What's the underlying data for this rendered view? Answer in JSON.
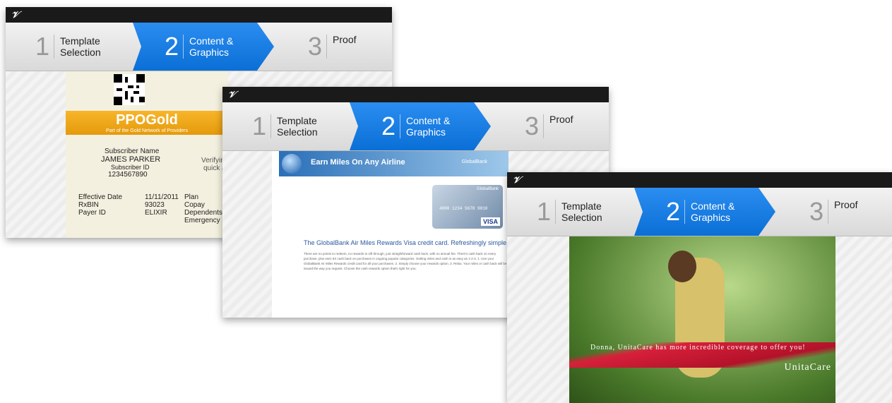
{
  "app": {
    "logo": "𝒱"
  },
  "steps": [
    {
      "num": "1",
      "label1": "Template",
      "label2": "Selection"
    },
    {
      "num": "2",
      "label1": "Content &",
      "label2": "Graphics"
    },
    {
      "num": "3",
      "label1": "Proof",
      "label2": ""
    }
  ],
  "window1": {
    "brand_main": "PPOGold",
    "brand_sub": "Part of the Gold Network of Providers",
    "subscriber_name_label": "Subscriber Name",
    "subscriber_name": "JAMES PARKER",
    "subscriber_id_label": "Subscriber ID",
    "subscriber_id": "1234567890",
    "verify_text": "Verifyin",
    "verify_text2": "quick a",
    "rows": [
      {
        "label": "Effective Date",
        "value": "11/11/2011",
        "col3": "Plan"
      },
      {
        "label": "RxBIN",
        "value": "93023",
        "col3": "Copay"
      },
      {
        "label": "Payer ID",
        "value": "ELIXIR",
        "col3": "Dependents"
      },
      {
        "label": "",
        "value": "",
        "col3": "Emergency"
      }
    ]
  },
  "window2": {
    "banner_text": "Earn Miles On Any Airline",
    "banner_brand": "GlobalBank",
    "card_brand": "GlobalBank",
    "card_number": "4000 1234 5678 9010",
    "visa": "VISA",
    "title": "The GlobalBank Air Miles Rewards Visa credit card. Refreshingly simple.",
    "body": "There are no points to redeem, no rewards to sift through, just straightforward cash back, with no annual fee. There's cash back on every purchase, plus earn 5X cash back on purchases in ongoing popular categories. Getting miles and cash is as easy as 1-2-3. 1. Use your GlobalBank Air Miles Rewards credit card for all your purchases. 2. Simply choose your rewards option. 3. Relax. Your miles or cash back will be issued the way you request. Choose the cash rewards option that's right for you."
  },
  "window3": {
    "tagline": "Donna, UnitaCare has more incredible coverage to offer you!",
    "brand": "UnitaCare"
  },
  "colors": {
    "active_step": "#0a6fd6",
    "gold": "#f0a81a",
    "ribbon": "#c8182f"
  }
}
